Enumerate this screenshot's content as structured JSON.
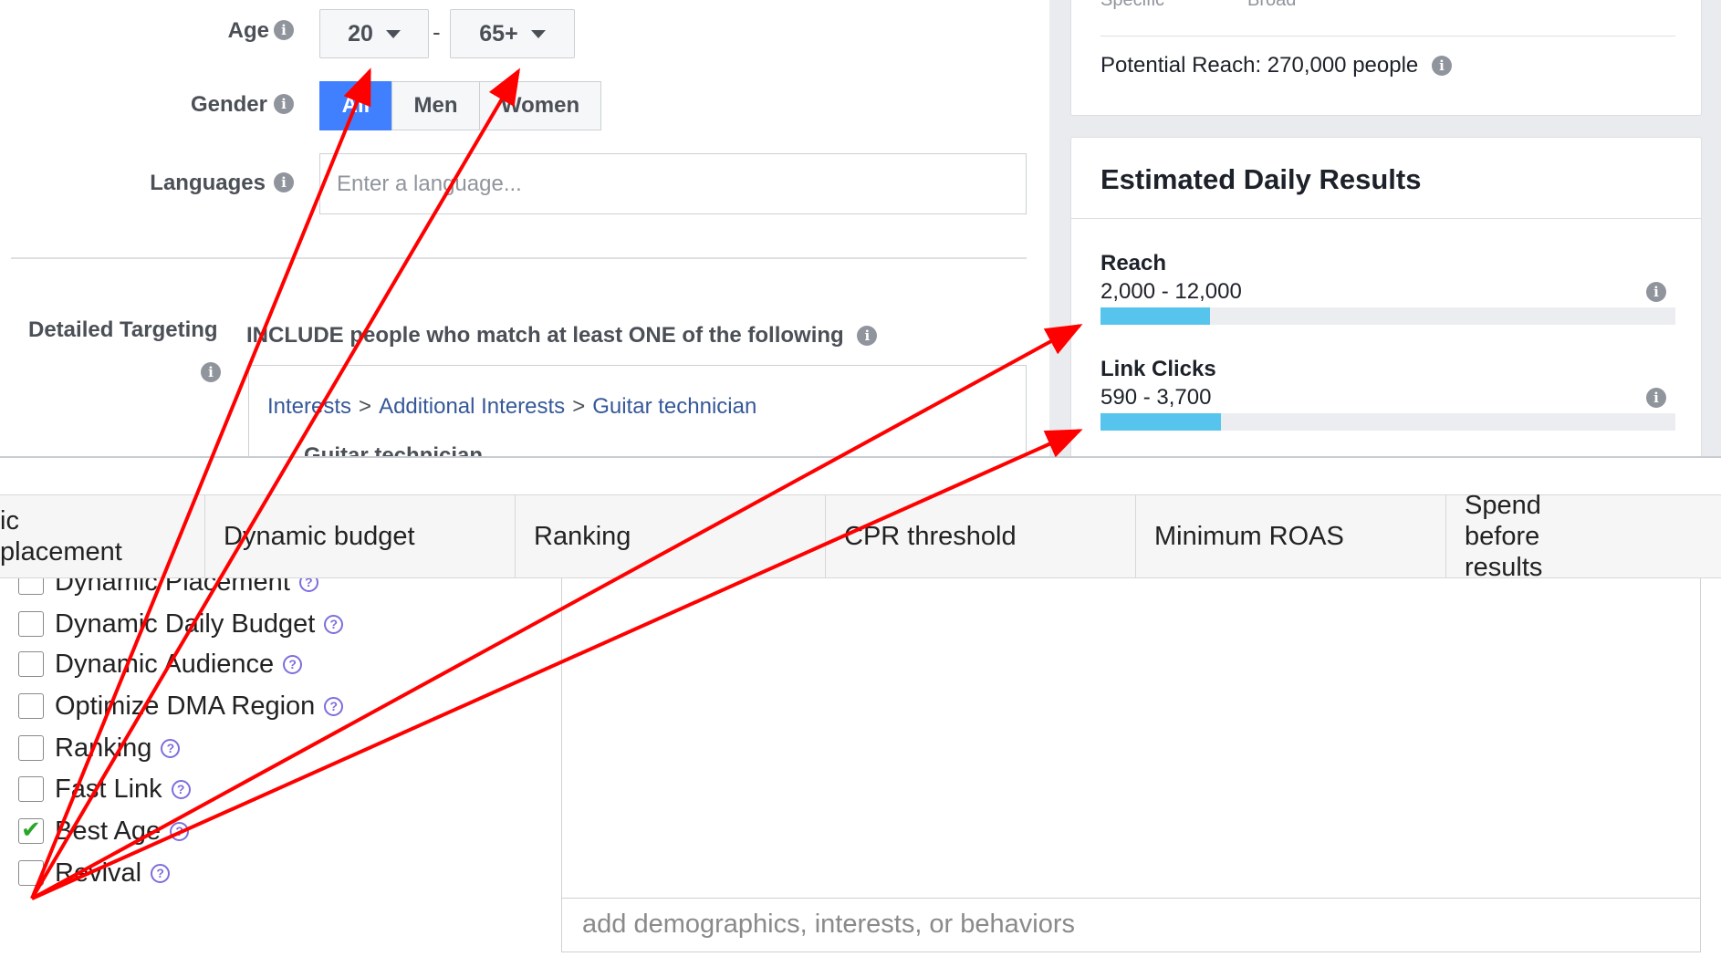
{
  "audience": {
    "age_label": "Age",
    "age_min": "20",
    "age_dash": "-",
    "age_max": "65+",
    "gender_label": "Gender",
    "gender_options": [
      "All",
      "Men",
      "Women"
    ],
    "gender_selected": "All",
    "languages_label": "Languages",
    "languages_placeholder": "Enter a language...",
    "detailed_targeting_label": "Detailed Targeting",
    "include_text": "INCLUDE people who match at least ONE of the following",
    "breadcrumb": [
      "Interests",
      "Additional Interests",
      "Guitar technician"
    ],
    "breadcrumb_sep": ">",
    "selected_interest": "Guitar technician"
  },
  "audience_size": {
    "scale_low": "Specific",
    "scale_high": "Broad",
    "potential_reach": "Potential Reach: 270,000 people"
  },
  "estimated_results": {
    "title": "Estimated Daily Results",
    "metrics": [
      {
        "label": "Reach",
        "value": "2,000 - 12,000",
        "bar_fraction": 0.19
      },
      {
        "label": "Link Clicks",
        "value": "590 - 3,700",
        "bar_fraction": 0.21
      }
    ]
  },
  "extension": {
    "columns": [
      "ic placement",
      "Dynamic budget",
      "Ranking",
      "CPR threshold",
      "Minimum ROAS",
      "Spend before results"
    ],
    "options": [
      {
        "label": "Dynamic Placement",
        "checked": false
      },
      {
        "label": "Dynamic Daily Budget",
        "checked": false
      },
      {
        "label": "Dynamic Audience",
        "checked": false
      },
      {
        "label": "Optimize DMA Region",
        "checked": false
      },
      {
        "label": "Ranking",
        "checked": false
      },
      {
        "label": "Fast Link",
        "checked": false
      },
      {
        "label": "Best Age",
        "checked": true
      },
      {
        "label": "Revival",
        "checked": false
      }
    ],
    "add_placeholder": "add demographics, interests, or behaviors"
  },
  "icons": {
    "info": "info-icon",
    "help": "question-circle-icon",
    "dropdown": "caret-down-icon",
    "check": "checkmark-icon"
  },
  "colors": {
    "accent_blue": "#4080ff",
    "link_blue": "#365899",
    "bar_fill": "#56c4ec",
    "annotation_arrow": "#ff0000",
    "check_green": "#2aa52a",
    "help_purple": "#7b6fdc"
  }
}
